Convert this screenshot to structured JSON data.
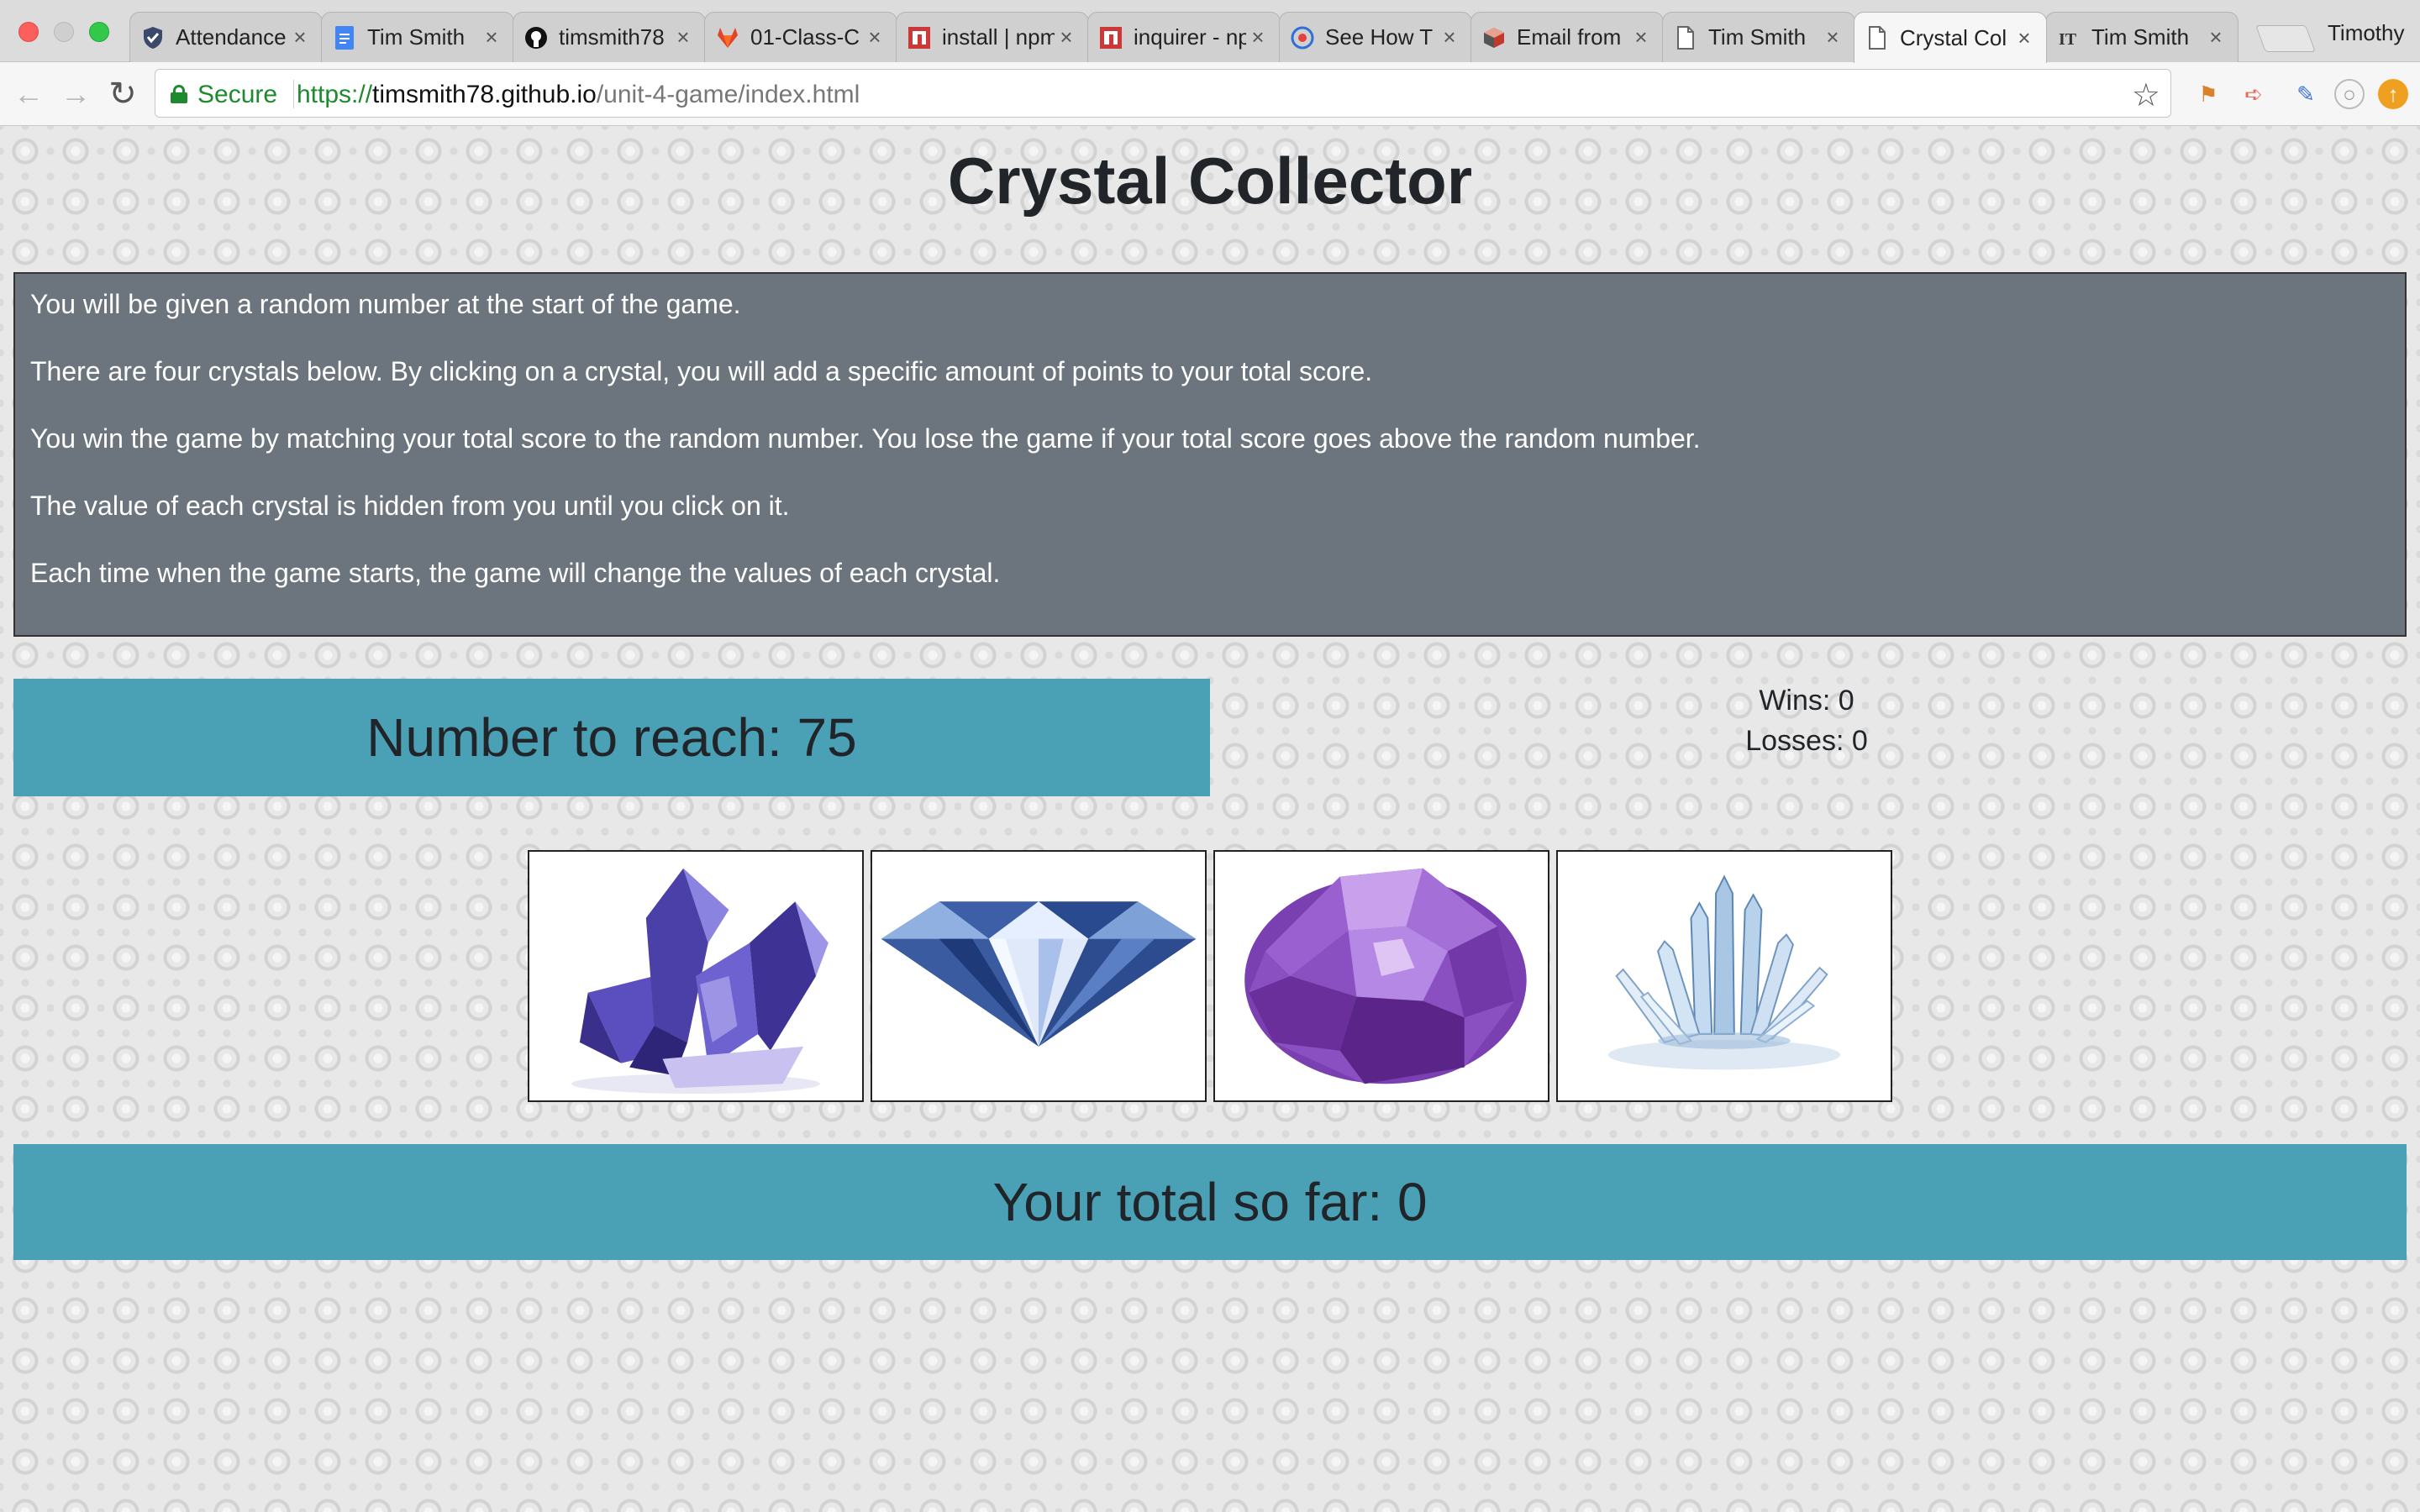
{
  "browser": {
    "tabs": [
      {
        "title": "Attendance",
        "icon": "shield-check-icon",
        "active": false
      },
      {
        "title": "Tim Smith",
        "icon": "google-doc-icon",
        "active": false
      },
      {
        "title": "timsmith78",
        "icon": "github-icon",
        "active": false
      },
      {
        "title": "01-Class-C",
        "icon": "gitlab-icon",
        "active": false
      },
      {
        "title": "install | npm",
        "icon": "npm-icon",
        "active": false
      },
      {
        "title": "inquirer - npm",
        "icon": "npm-icon",
        "active": false
      },
      {
        "title": "See How T",
        "icon": "globe-icon",
        "active": false
      },
      {
        "title": "Email from",
        "icon": "box-icon",
        "active": false
      },
      {
        "title": "Tim Smith",
        "icon": "page-icon",
        "active": false
      },
      {
        "title": "Crystal Col",
        "icon": "page-icon",
        "active": true
      },
      {
        "title": "Tim Smith",
        "icon": "it-icon",
        "active": false
      }
    ],
    "profile_name": "Timothy",
    "secure_label": "Secure",
    "url_scheme": "https://",
    "url_host": "timsmith78.github.io",
    "url_path": "/unit-4-game/index.html"
  },
  "game": {
    "title": "Crystal Collector",
    "instructions": [
      "You will be given a random number at the start of the game.",
      "There are four crystals below. By clicking on a crystal, you will add a specific amount of points to your total score.",
      "You win the game by matching your total score to the random number. You lose the game if your total score goes above the random number.",
      "The value of each crystal is hidden from you until you click on it.",
      "Each time when the game starts, the game will change the values of each crystal."
    ],
    "target_label": "Number to reach: 75",
    "wins_label": "Wins: 0",
    "losses_label": "Losses: 0",
    "total_label": "Your total so far: 0",
    "crystals": [
      {
        "name": "purple-cluster-crystal",
        "color": "#4b3fa8"
      },
      {
        "name": "diamond-crystal",
        "color": "#3d5fa8"
      },
      {
        "name": "amethyst-crystal",
        "color": "#8a4fc0"
      },
      {
        "name": "quartz-cluster-crystal",
        "color": "#8ab4d8"
      }
    ]
  }
}
